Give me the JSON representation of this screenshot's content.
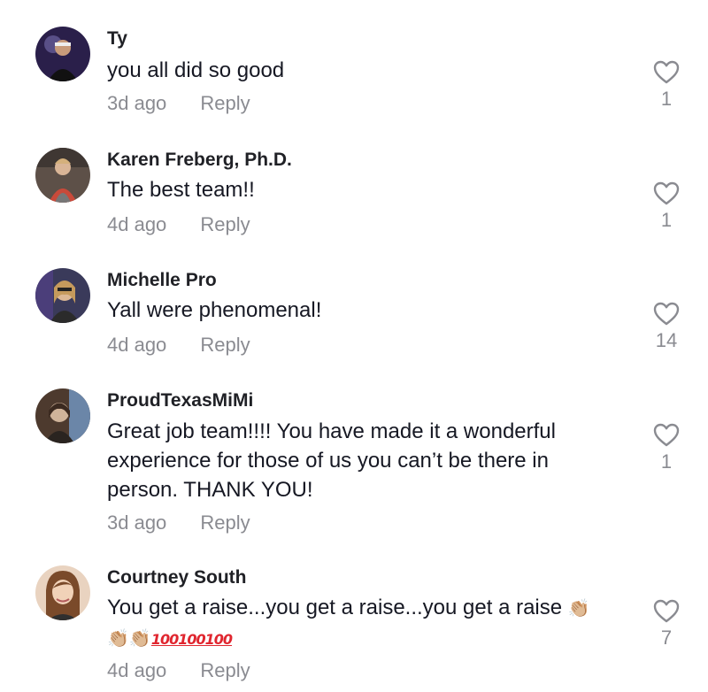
{
  "comments": [
    {
      "username": "Ty",
      "text": "you all did so good",
      "time": "3d ago",
      "reply_label": "Reply",
      "likes": "1",
      "avatar_colors": [
        "#2a1f4a",
        "#7a6fb0"
      ]
    },
    {
      "username": "Karen Freberg, Ph.D.",
      "text": "The best team!!",
      "time": "4d ago",
      "reply_label": "Reply",
      "likes": "1",
      "avatar_colors": [
        "#5d5048",
        "#c9a990"
      ]
    },
    {
      "username": "Michelle Pro",
      "text": "Yall were phenomenal!",
      "time": "4d ago",
      "reply_label": "Reply",
      "likes": "14",
      "avatar_colors": [
        "#3a3a5a",
        "#d7b58f"
      ]
    },
    {
      "username": "ProudTexasMiMi",
      "text": "Great job team!!!! You have made it a wonderful experience for those of us you can’t be there in person. THANK YOU!",
      "time": "3d ago",
      "reply_label": "Reply",
      "likes": "1",
      "avatar_colors": [
        "#4d3a2e",
        "#d0b49a"
      ]
    },
    {
      "username": "Courtney South",
      "text": "You get a raise...you get a raise...you get a raise",
      "emoji_clap": "👏🏼",
      "emoji_line_claps": "👏🏼👏🏼",
      "emoji_hundreds": "100100100",
      "time": "4d ago",
      "reply_label": "Reply",
      "likes": "7",
      "avatar_colors": [
        "#e9d3c0",
        "#7a4a2a"
      ]
    }
  ],
  "icons": {
    "like": "heart-outline-icon"
  },
  "colors": {
    "text": "#161823",
    "muted": "#8a8b91",
    "background": "#ffffff"
  }
}
